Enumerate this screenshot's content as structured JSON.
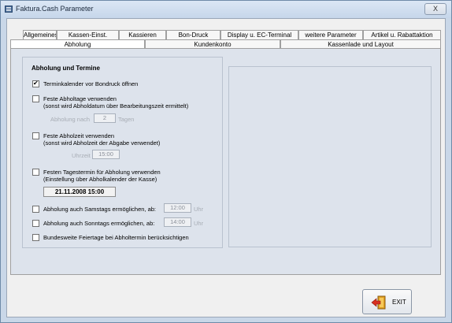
{
  "window": {
    "title": "Faktura.Cash Parameter",
    "close_label": "X"
  },
  "tabs_row1": [
    "Allgemeines",
    "Kassen-Einst.",
    "Kassieren",
    "Bon-Druck",
    "Display u. EC-Terminal",
    "weitere Parameter",
    "Artikel u. Rabattaktion"
  ],
  "tabs_row2": [
    "Abholung",
    "Kundenkonto",
    "Kassenlade und Layout"
  ],
  "active_tab": "Abholung",
  "section": {
    "title": "Abholung und Termine"
  },
  "options": {
    "terminkalender": {
      "label": "Terminkalender vor Bondruck öffnen",
      "checked": true
    },
    "feste_abholtage": {
      "label": "Feste Abholtage verwenden",
      "sub": "(sonst wird Abholdatum über Bearbeitungszeit ermittelt)",
      "field_label": "Abholung nach",
      "value": "2",
      "unit": "Tagen",
      "checked": false
    },
    "feste_abholzeit": {
      "label": "Feste Abholzeit verwenden",
      "sub": "(sonst wird Abholzeit der Abgabe verwendet)",
      "field_label": "Uhrzeit",
      "value": "15:00",
      "checked": false
    },
    "tagestermin": {
      "label": "Festen Tagestermin für Abholung verwenden",
      "sub": "(Einstellung über Abholkalender der Kasse)",
      "value": "21.11.2008 15:00",
      "checked": false
    },
    "samstags": {
      "label": "Abholung auch Samstags ermöglichen, ab:",
      "value": "12:00",
      "unit": "Uhr",
      "checked": false
    },
    "sonntags": {
      "label": "Abholung auch Sonntags ermöglichen,  ab:",
      "value": "14:00",
      "unit": "Uhr",
      "checked": false
    },
    "feiertage": {
      "label": "Bundesweite Feiertage bei Abholtermin berücksichtigen",
      "checked": false
    }
  },
  "exit": {
    "label": "EXIT"
  }
}
